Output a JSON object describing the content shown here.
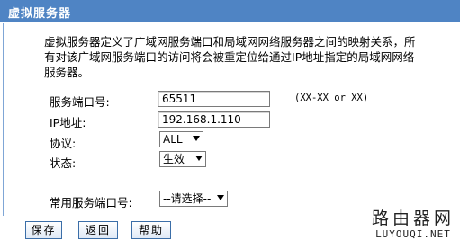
{
  "header": {
    "title": "虚拟服务器"
  },
  "description": "虚拟服务器定义了广域网服务端口和局域网网络服务器之间的映射关系，所有对该广域网服务端口的访问将会被重定位给通过IP地址指定的局域网网络服务器。",
  "form": {
    "port_label": "服务端口号:",
    "port_value": "65511",
    "port_hint": "(XX-XX or XX)",
    "ip_label": "IP地址:",
    "ip_value": "192.168.1.110",
    "protocol_label": "协议:",
    "protocol_value": "ALL",
    "status_label": "状态:",
    "status_value": "生效",
    "common_port_label": "常用服务端口号:",
    "common_port_value": "--请选择--"
  },
  "buttons": {
    "save": "保存",
    "back": "返回",
    "help": "帮助"
  },
  "watermark": {
    "cn": "路由器网",
    "en": "LUYOUQI.NET"
  }
}
